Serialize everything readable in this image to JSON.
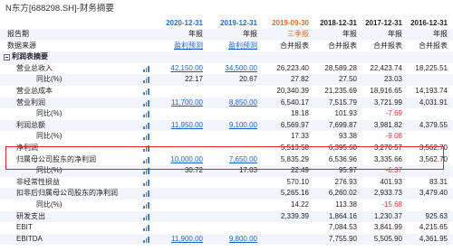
{
  "title": "N东方[688298.SH]-财务摘要",
  "header": {
    "dates": [
      "2020-12-31",
      "2019-12-31",
      "2019-09-30",
      "2018-12-31",
      "2017-12-31",
      "2016-12-31"
    ],
    "period_label": "报告期",
    "periods": [
      "年报",
      "年报",
      "三季报",
      "年报",
      "年报",
      "年报"
    ],
    "source_label": "数据来源",
    "sources": [
      "盈利预测",
      "盈利预测",
      "合并报表",
      "合并报表",
      "合并报表",
      "合并报表"
    ]
  },
  "section_profit": "利润表摘要",
  "rows": {
    "revenue": {
      "label": "营业总收入",
      "values": [
        "42,150.00",
        "34,500.00",
        "26,223.40",
        "28,589.28",
        "22,423.74",
        "18,225.51"
      ]
    },
    "revenue_yoy": {
      "label": "同比(%)",
      "values": [
        "22.17",
        "20.67",
        "27.82",
        "27.50",
        "23.03",
        ""
      ]
    },
    "cost": {
      "label": "营业总成本",
      "values": [
        "",
        "",
        "20,340.39",
        "21,235.69",
        "18,916.65",
        "14,193.74"
      ]
    },
    "op_profit": {
      "label": "营业利润",
      "values": [
        "11,700.00",
        "8,850.00",
        "6,540.17",
        "7,515.79",
        "3,721.99",
        "4,031.91"
      ]
    },
    "op_profit_yoy": {
      "label": "同比(%)",
      "values": [
        "",
        "",
        "18.18",
        "101.93",
        "-7.69",
        ""
      ]
    },
    "total_profit": {
      "label": "利润总额",
      "values": [
        "11,950.00",
        "9,100.00",
        "6,569.97",
        "7,699.87",
        "3,981.82",
        "4,379.55"
      ]
    },
    "total_profit_yoy": {
      "label": "同比(%)",
      "values": [
        "",
        "",
        "17.33",
        "93.38",
        "-9.08",
        ""
      ]
    },
    "net_profit": {
      "label": "净利润",
      "values": [
        "",
        "",
        "5,513.58",
        "6,395.60",
        "3,270.57",
        "3,562.70"
      ]
    },
    "np_parent": {
      "label": "归属母公司股东的净利润",
      "values": [
        "10,000.00",
        "7,650.00",
        "5,835.29",
        "6,536.96",
        "3,335.66",
        "3,562.70"
      ]
    },
    "np_parent_yoy": {
      "label": "同比(%)",
      "values": [
        "30.72",
        "17.03",
        "22.49",
        "95.97",
        "-6.37",
        ""
      ]
    },
    "nonrecurring": {
      "label": "非经常性损益",
      "values": [
        "",
        "",
        "570.10",
        "276.93",
        "401.93",
        "83.31"
      ]
    },
    "np_deducted": {
      "label": "扣非后归属母公司股东的净利润",
      "values": [
        "",
        "",
        "5,265.16",
        "6,260.02",
        "2,933.73",
        "3,479.40"
      ]
    },
    "np_deducted_yoy": {
      "label": "同比(%)",
      "values": [
        "",
        "",
        "14.22",
        "113.38",
        "-15.68",
        ""
      ]
    },
    "rnd": {
      "label": "研发支出",
      "values": [
        "",
        "",
        "2,339.39",
        "1,864.16",
        "1,230.37",
        "925.63"
      ]
    },
    "ebit": {
      "label": "EBIT",
      "values": [
        "",
        "",
        "",
        "7,084.53",
        "3,841.99",
        "4,215.65"
      ]
    },
    "ebitda": {
      "label": "EBITDA",
      "values": [
        "11,900.00",
        "9,800.00",
        "",
        "7,755.90",
        "5,505.90",
        "4,361.95"
      ]
    }
  },
  "colors": {
    "accent_blue": "#1e6fd0",
    "accent_orange": "#e8691d",
    "highlight_border": "#e0242b",
    "negative": "#d33"
  },
  "icons": {
    "row_chart": "bar-chart-icon",
    "section_toggle": "minus-box-icon"
  }
}
